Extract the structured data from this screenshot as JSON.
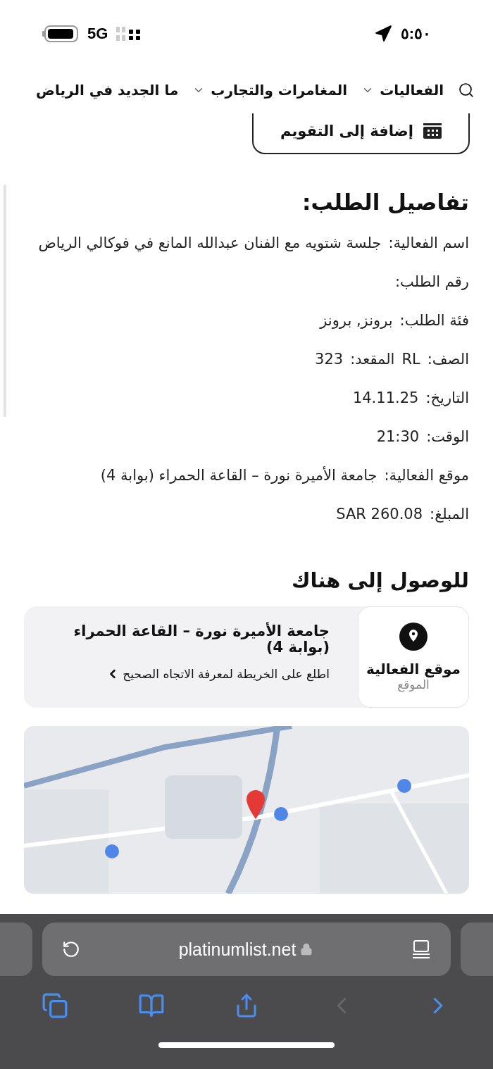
{
  "status_bar": {
    "time": "٥:٥٠",
    "network": "5G"
  },
  "nav": {
    "items": [
      {
        "label": "الفعاليات",
        "has_menu": true
      },
      {
        "label": "المغامرات والتجارب",
        "has_menu": true
      },
      {
        "label": "ما الجديد في الرياض",
        "has_menu": false
      }
    ]
  },
  "calendar_button": {
    "label": "إضافة إلى التقويم"
  },
  "order_details": {
    "title": "تفاصيل الطلب:",
    "rows": [
      {
        "pairs": [
          {
            "label": "اسم الفعالية:",
            "value": "جلسة شتويه مع الفنان عبدالله المانع في فوكالي الرياض"
          }
        ]
      },
      {
        "pairs": [
          {
            "label": "رقم الطلب:"
          }
        ]
      },
      {
        "pairs": [
          {
            "label": "فئة الطلب:",
            "value": "برونز, برونز"
          }
        ]
      },
      {
        "pairs": [
          {
            "label": "الصف:",
            "value": "RL"
          },
          {
            "label": "المقعد:",
            "value": "323"
          }
        ]
      },
      {
        "pairs": [
          {
            "label": "التاريخ:",
            "value": "14.11.25"
          }
        ]
      },
      {
        "pairs": [
          {
            "label": "الوقت:",
            "value": "21:30"
          }
        ]
      },
      {
        "pairs": [
          {
            "label": "موقع الفعالية:",
            "value": "جامعة الأميرة نورة – القاعة الحمراء (بوابة 4)"
          }
        ]
      },
      {
        "pairs": [
          {
            "label": "المبلغ:",
            "value": "SAR 260.08"
          }
        ]
      }
    ]
  },
  "directions": {
    "title": "للوصول إلى هناك",
    "venue_tile": {
      "title": "موقع الفعالية",
      "subtitle": "الموقع"
    },
    "venue_name": "جامعة الأميرة نورة – القاعة الحمراء (بوابة 4)",
    "map_link": "اطلع على الخريطة لمعرفة الاتجاه الصحيح"
  },
  "browser": {
    "url": "platinumlist.net",
    "back": {
      "disabled": true
    },
    "forward": {
      "disabled": false
    }
  }
}
